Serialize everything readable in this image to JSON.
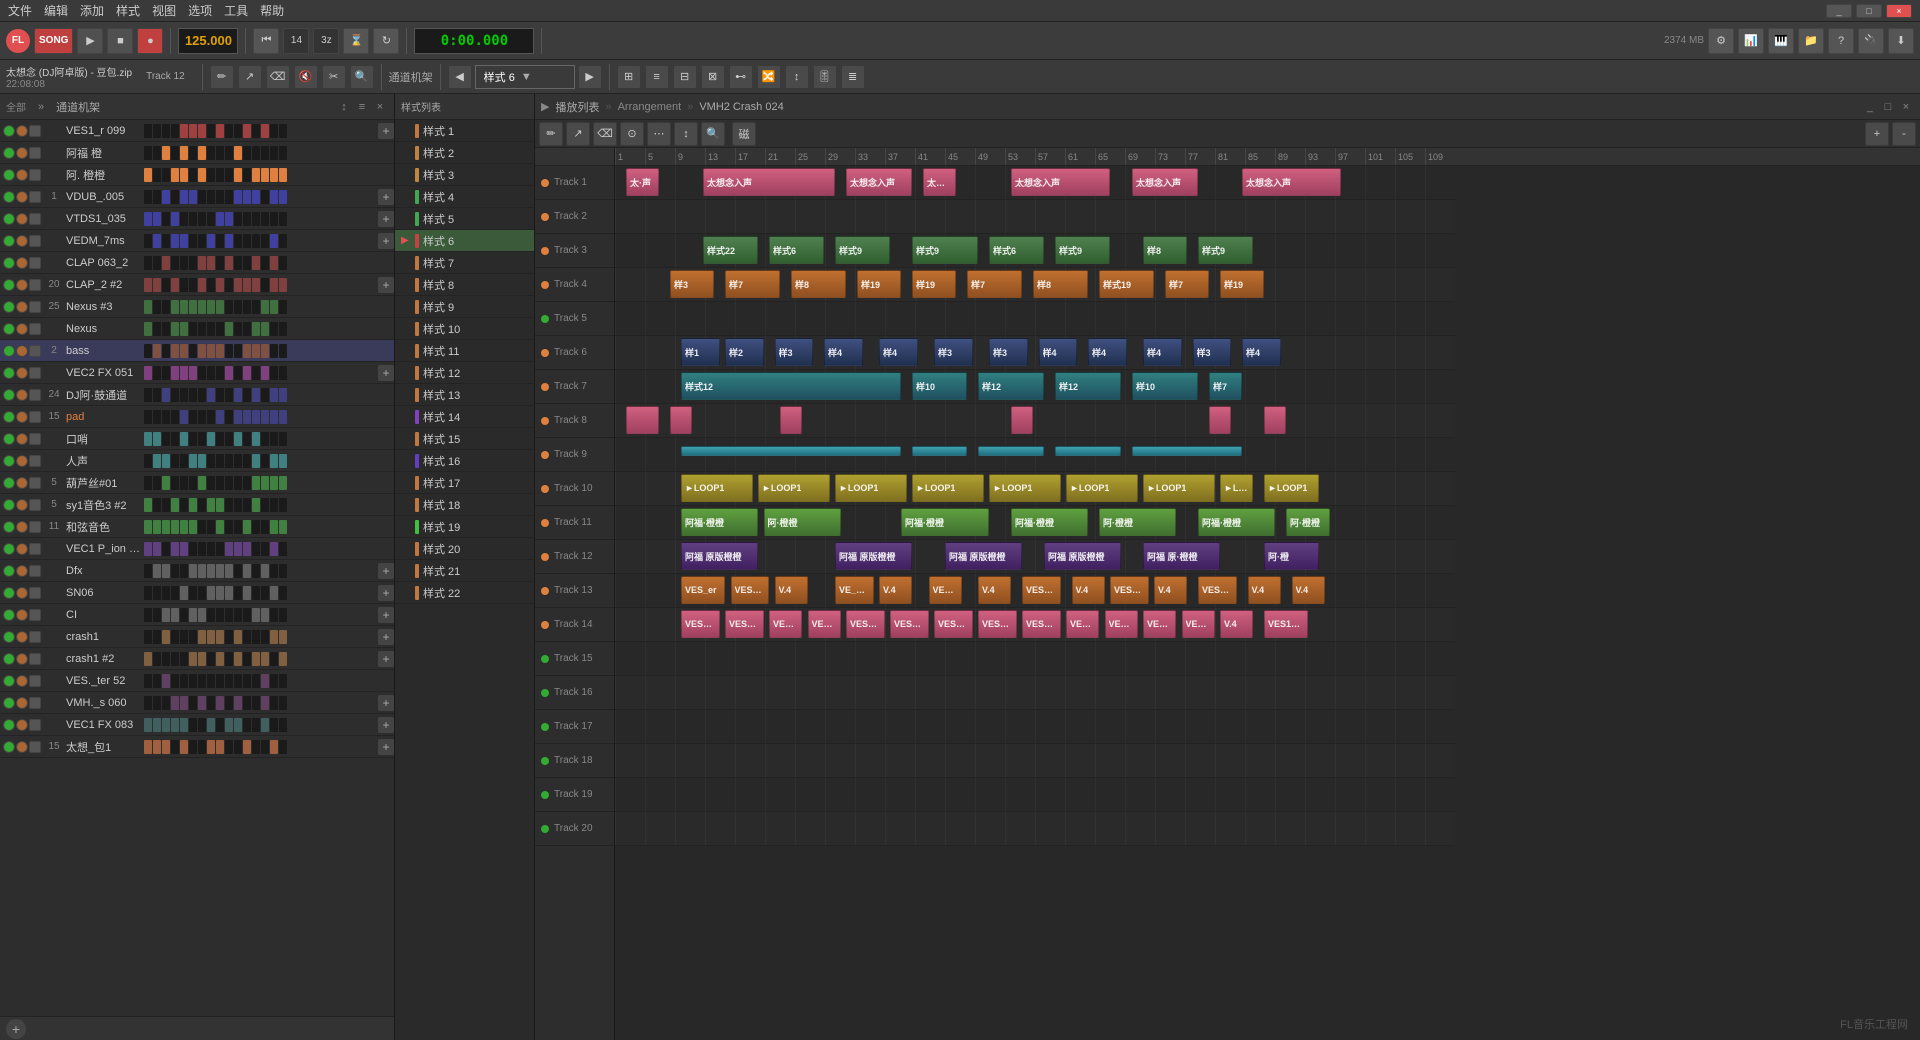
{
  "menu": {
    "items": [
      "文件",
      "编辑",
      "添加",
      "样式",
      "视图",
      "选项",
      "工具",
      "帮助"
    ]
  },
  "toolbar": {
    "song_mode": "SONG",
    "bpm": "125.000",
    "time": "0:00.000",
    "beats_indicator": "M:S",
    "numerator": "14",
    "denominator": "2374 MB"
  },
  "toolbar2": {
    "pattern_label": "样式 6",
    "channel_rack_label": "通道机架",
    "track_count": "Track 12"
  },
  "project": {
    "name": "太想念 (DJ阿卓版) - 豆包.zip",
    "time": "22:08:08"
  },
  "arrangement": {
    "title": "播放列表",
    "path": "Arrangement",
    "clip_name": "VMH2 Crash 024"
  },
  "channels": [
    {
      "num": "",
      "name": "VES1_r 099",
      "color": "#a04040",
      "has_plus": true
    },
    {
      "num": "",
      "name": "阿福 橙",
      "color": "#e08040",
      "has_plus": false
    },
    {
      "num": "",
      "name": "阿. 橙橙",
      "color": "#e08040",
      "has_plus": false
    },
    {
      "num": "1",
      "name": "VDUB_.005",
      "color": "#4040a0",
      "has_plus": true
    },
    {
      "num": "",
      "name": "VTDS1_035",
      "color": "#4040a0",
      "has_plus": true
    },
    {
      "num": "",
      "name": "VEDM_7ms",
      "color": "#4040a0",
      "has_plus": true
    },
    {
      "num": "",
      "name": "CLAP 063_2",
      "color": "#804040",
      "has_plus": false
    },
    {
      "num": "20",
      "name": "CLAP_2 #2",
      "color": "#804040",
      "has_plus": true
    },
    {
      "num": "25",
      "name": "Nexus #3",
      "color": "#407040",
      "has_plus": false
    },
    {
      "num": "",
      "name": "Nexus",
      "color": "#407040",
      "has_plus": false
    },
    {
      "num": "2",
      "name": "bass",
      "color": "#805040",
      "has_plus": false
    },
    {
      "num": "",
      "name": "VEC2 FX 051",
      "color": "#804080",
      "has_plus": true
    },
    {
      "num": "24",
      "name": "DJ阿·鼓通道",
      "color": "#404080",
      "has_plus": false
    },
    {
      "num": "15",
      "name": "pad",
      "color": "#404080",
      "has_plus": false
    },
    {
      "num": "",
      "name": "口哨",
      "color": "#408080",
      "has_plus": false
    },
    {
      "num": "",
      "name": "人声",
      "color": "#408080",
      "has_plus": false
    },
    {
      "num": "5",
      "name": "葫芦丝#01",
      "color": "#408040",
      "has_plus": false
    },
    {
      "num": "5",
      "name": "sy1音色3 #2",
      "color": "#408040",
      "has_plus": false
    },
    {
      "num": "11",
      "name": "和弦音色",
      "color": "#408040",
      "has_plus": false
    },
    {
      "num": "",
      "name": "VEC1 P_ion 025",
      "color": "#604080",
      "has_plus": false
    },
    {
      "num": "",
      "name": "Dfx",
      "color": "#606060",
      "has_plus": true
    },
    {
      "num": "",
      "name": "SN06",
      "color": "#606060",
      "has_plus": true
    },
    {
      "num": "",
      "name": "CI",
      "color": "#606060",
      "has_plus": true
    },
    {
      "num": "",
      "name": "crash1",
      "color": "#806040",
      "has_plus": true
    },
    {
      "num": "",
      "name": "crash1 #2",
      "color": "#806040",
      "has_plus": true
    },
    {
      "num": "",
      "name": "VES._ter 52",
      "color": "#604060",
      "has_plus": false
    },
    {
      "num": "",
      "name": "VMH._s 060",
      "color": "#604060",
      "has_plus": true
    },
    {
      "num": "",
      "name": "VEC1 FX 083",
      "color": "#406060",
      "has_plus": true
    },
    {
      "num": "15",
      "name": "太想_包1",
      "color": "#a06040",
      "has_plus": true
    }
  ],
  "patterns": [
    {
      "name": "样式 1",
      "color": "#c07840",
      "selected": false
    },
    {
      "name": "样式 2",
      "color": "#c08040",
      "selected": false
    },
    {
      "name": "样式 3",
      "color": "#c08840",
      "selected": false
    },
    {
      "name": "样式 4",
      "color": "#40a850",
      "selected": false
    },
    {
      "name": "样式 5",
      "color": "#40a850",
      "selected": false
    },
    {
      "name": "样式 6",
      "color": "#c84040",
      "selected": true
    },
    {
      "name": "样式 7",
      "color": "#c07840",
      "selected": false
    },
    {
      "name": "样式 8",
      "color": "#c07840",
      "selected": false
    },
    {
      "name": "样式 9",
      "color": "#c07840",
      "selected": false
    },
    {
      "name": "样式 10",
      "color": "#c07840",
      "selected": false
    },
    {
      "name": "样式 11",
      "color": "#c07840",
      "selected": false
    },
    {
      "name": "样式 12",
      "color": "#c07840",
      "selected": false
    },
    {
      "name": "样式 13",
      "color": "#c07840",
      "selected": false
    },
    {
      "name": "样式 14",
      "color": "#8040c0",
      "selected": false
    },
    {
      "name": "样式 15",
      "color": "#c07840",
      "selected": false
    },
    {
      "name": "样式 16",
      "color": "#6040c0",
      "selected": false
    },
    {
      "name": "样式 17",
      "color": "#c07840",
      "selected": false
    },
    {
      "name": "样式 18",
      "color": "#c07840",
      "selected": false
    },
    {
      "name": "样式 19",
      "color": "#40c040",
      "selected": false
    },
    {
      "name": "样式 20",
      "color": "#c07840",
      "selected": false
    },
    {
      "name": "样式 21",
      "color": "#c07840",
      "selected": false
    },
    {
      "name": "样式 22",
      "color": "#c07840",
      "selected": false
    }
  ],
  "tracks": [
    {
      "num": 1,
      "label": "Track 1",
      "dot_color": "orange"
    },
    {
      "num": 2,
      "label": "Track 2",
      "dot_color": "orange"
    },
    {
      "num": 3,
      "label": "Track 3",
      "dot_color": "orange"
    },
    {
      "num": 4,
      "label": "Track 4",
      "dot_color": "orange"
    },
    {
      "num": 5,
      "label": "Track 5",
      "dot_color": "green"
    },
    {
      "num": 6,
      "label": "Track 6",
      "dot_color": "orange"
    },
    {
      "num": 7,
      "label": "Track 7",
      "dot_color": "orange"
    },
    {
      "num": 8,
      "label": "Track 8",
      "dot_color": "orange"
    },
    {
      "num": 9,
      "label": "Track 9",
      "dot_color": "orange"
    },
    {
      "num": 10,
      "label": "Track 10",
      "dot_color": "orange"
    },
    {
      "num": 11,
      "label": "Track 11",
      "dot_color": "orange"
    },
    {
      "num": 12,
      "label": "Track 12",
      "dot_color": "orange"
    },
    {
      "num": 13,
      "label": "Track 13",
      "dot_color": "orange"
    },
    {
      "num": 14,
      "label": "Track 14",
      "dot_color": "orange"
    },
    {
      "num": 15,
      "label": "Track 15",
      "dot_color": "green"
    },
    {
      "num": 16,
      "label": "Track 16",
      "dot_color": "green"
    },
    {
      "num": 17,
      "label": "Track 17",
      "dot_color": "green"
    },
    {
      "num": 18,
      "label": "Track 18",
      "dot_color": "green"
    },
    {
      "num": 19,
      "label": "Track 19",
      "dot_color": "green"
    },
    {
      "num": 20,
      "label": "Track 20",
      "dot_color": "green"
    }
  ],
  "ruler": {
    "marks": [
      "1",
      "5",
      "9",
      "13",
      "17",
      "21",
      "25",
      "29",
      "33",
      "37",
      "41",
      "45",
      "49",
      "53",
      "57",
      "61",
      "65",
      "69",
      "73",
      "77",
      "81",
      "85",
      "89",
      "93",
      "97",
      "101",
      "105",
      "109"
    ]
  },
  "watermark": "FL音乐工程网"
}
